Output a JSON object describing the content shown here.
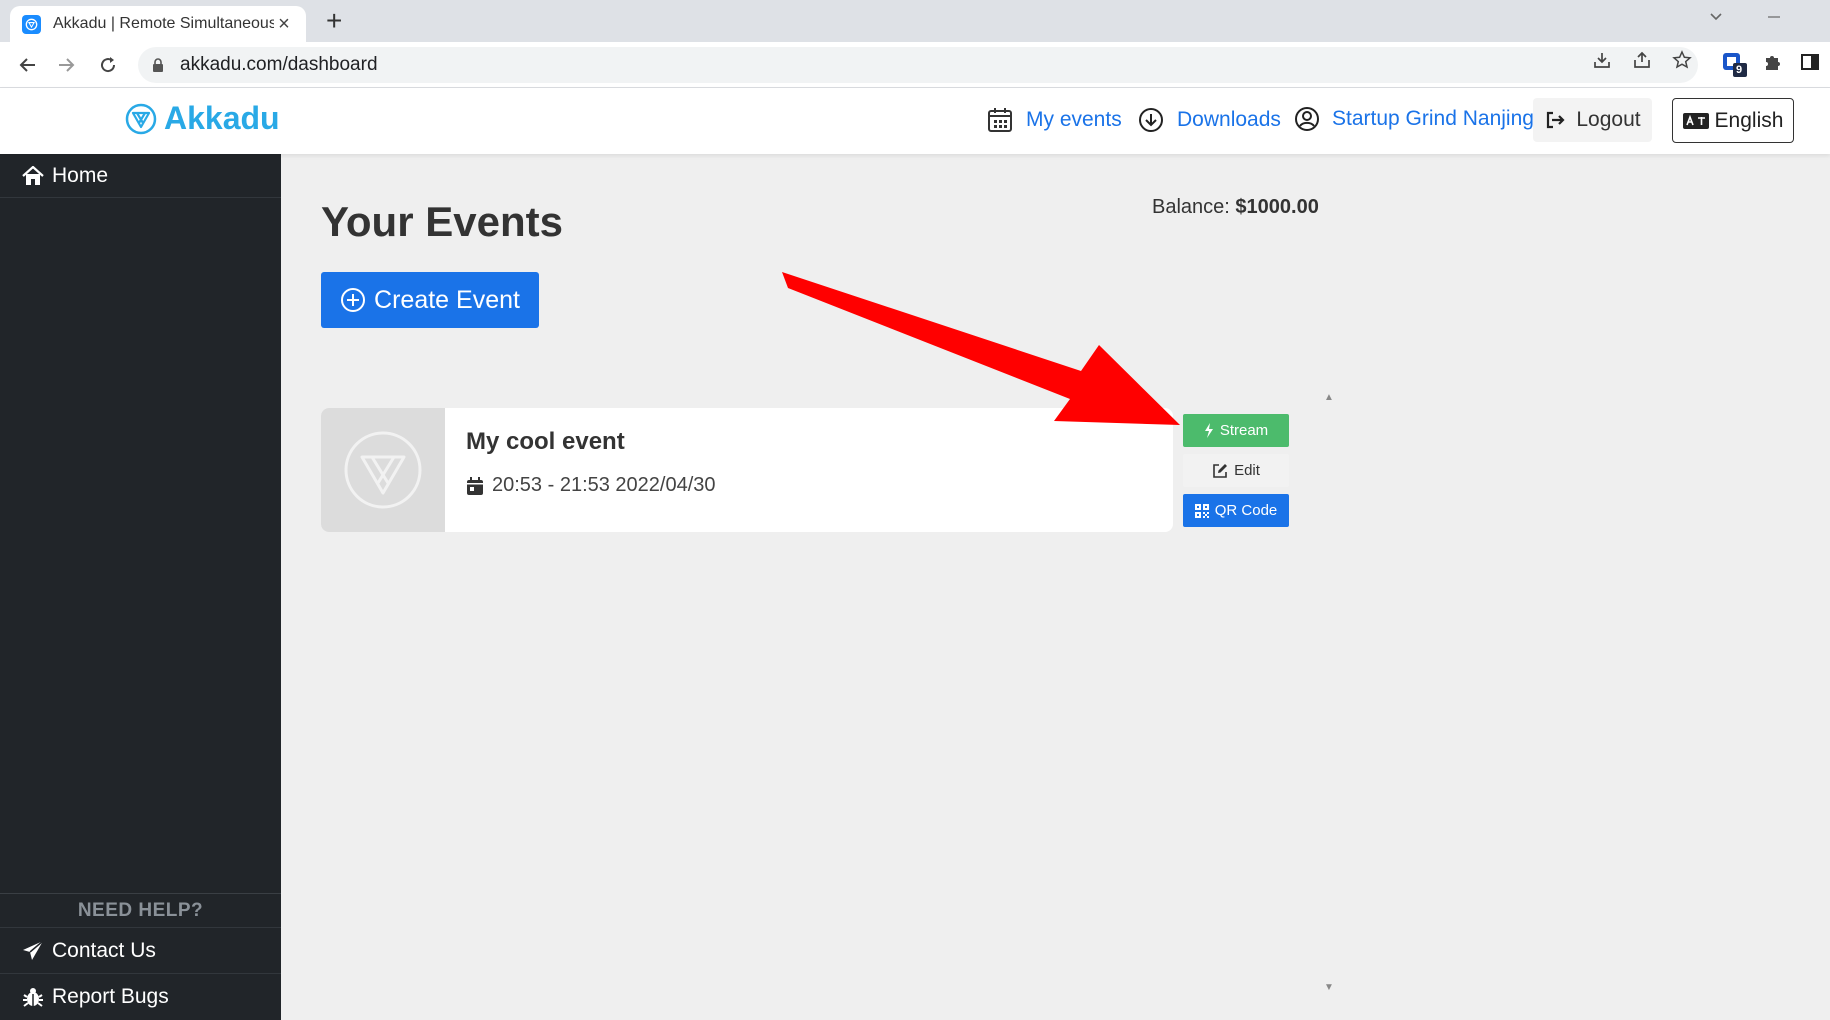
{
  "browser": {
    "tab_title": "Akkadu | Remote Simultaneous",
    "tab_close": "×",
    "new_tab": "+",
    "url": "akkadu.com/dashboard",
    "extension_badge": "9"
  },
  "header": {
    "brand": "Akkadu",
    "nav": [
      {
        "label": "My events",
        "icon": "calendar-icon"
      },
      {
        "label": "Downloads",
        "icon": "download-circle-icon"
      },
      {
        "label": "Startup Grind Nanjing",
        "icon": "user-circle-icon"
      }
    ],
    "logout": "Logout",
    "language": "English"
  },
  "sidebar": {
    "home": "Home",
    "help_title": "NEED HELP?",
    "contact": "Contact Us",
    "report": "Report Bugs"
  },
  "main": {
    "title": "Your Events",
    "balance_label": "Balance:",
    "balance_value": "$1000.00",
    "create_button": "Create Event"
  },
  "events": [
    {
      "name": "My cool event",
      "time": "20:53 - 21:53 2022/04/30",
      "actions": {
        "stream": "Stream",
        "edit": "Edit",
        "qr": "QR Code"
      }
    }
  ],
  "colors": {
    "brand": "#29a9e6",
    "primary": "#1a73e8",
    "stream": "#4cbb6c",
    "sidebar": "#212529",
    "arrow": "#ff0000"
  }
}
